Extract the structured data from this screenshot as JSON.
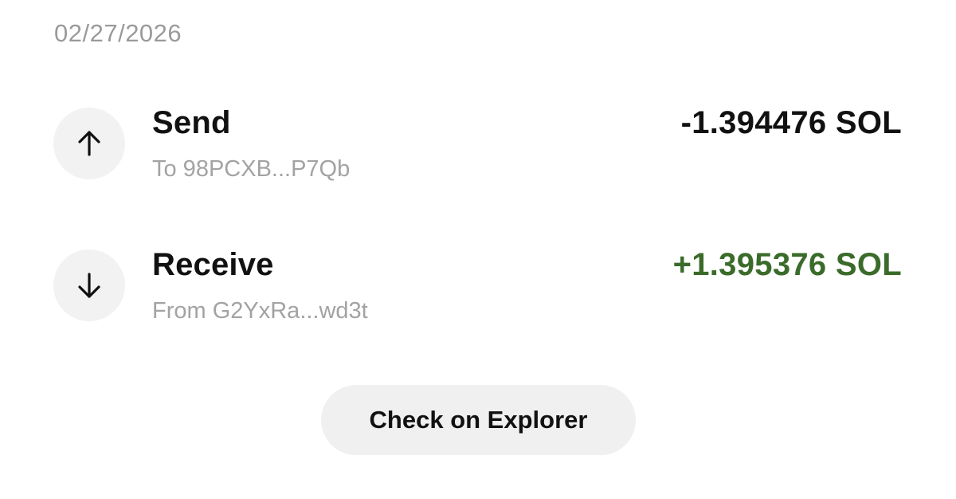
{
  "date": "02/27/2026",
  "transactions": [
    {
      "type": "Send",
      "icon": "arrow-up-icon",
      "counterparty": "To 98PCXB...P7Qb",
      "amount": "-1.394476 SOL",
      "amount_color": "#111111"
    },
    {
      "type": "Receive",
      "icon": "arrow-down-icon",
      "counterparty": "From G2YxRa...wd3t",
      "amount": "+1.395376 SOL",
      "amount_color": "#3b6b2a"
    }
  ],
  "actions": {
    "explorer_label": "Check on Explorer"
  },
  "colors": {
    "background": "#ffffff",
    "muted_text": "#9a9a9a",
    "icon_circle": "#f2f2f2",
    "button_bg": "#f0f0f0",
    "positive": "#3b6b2a"
  }
}
